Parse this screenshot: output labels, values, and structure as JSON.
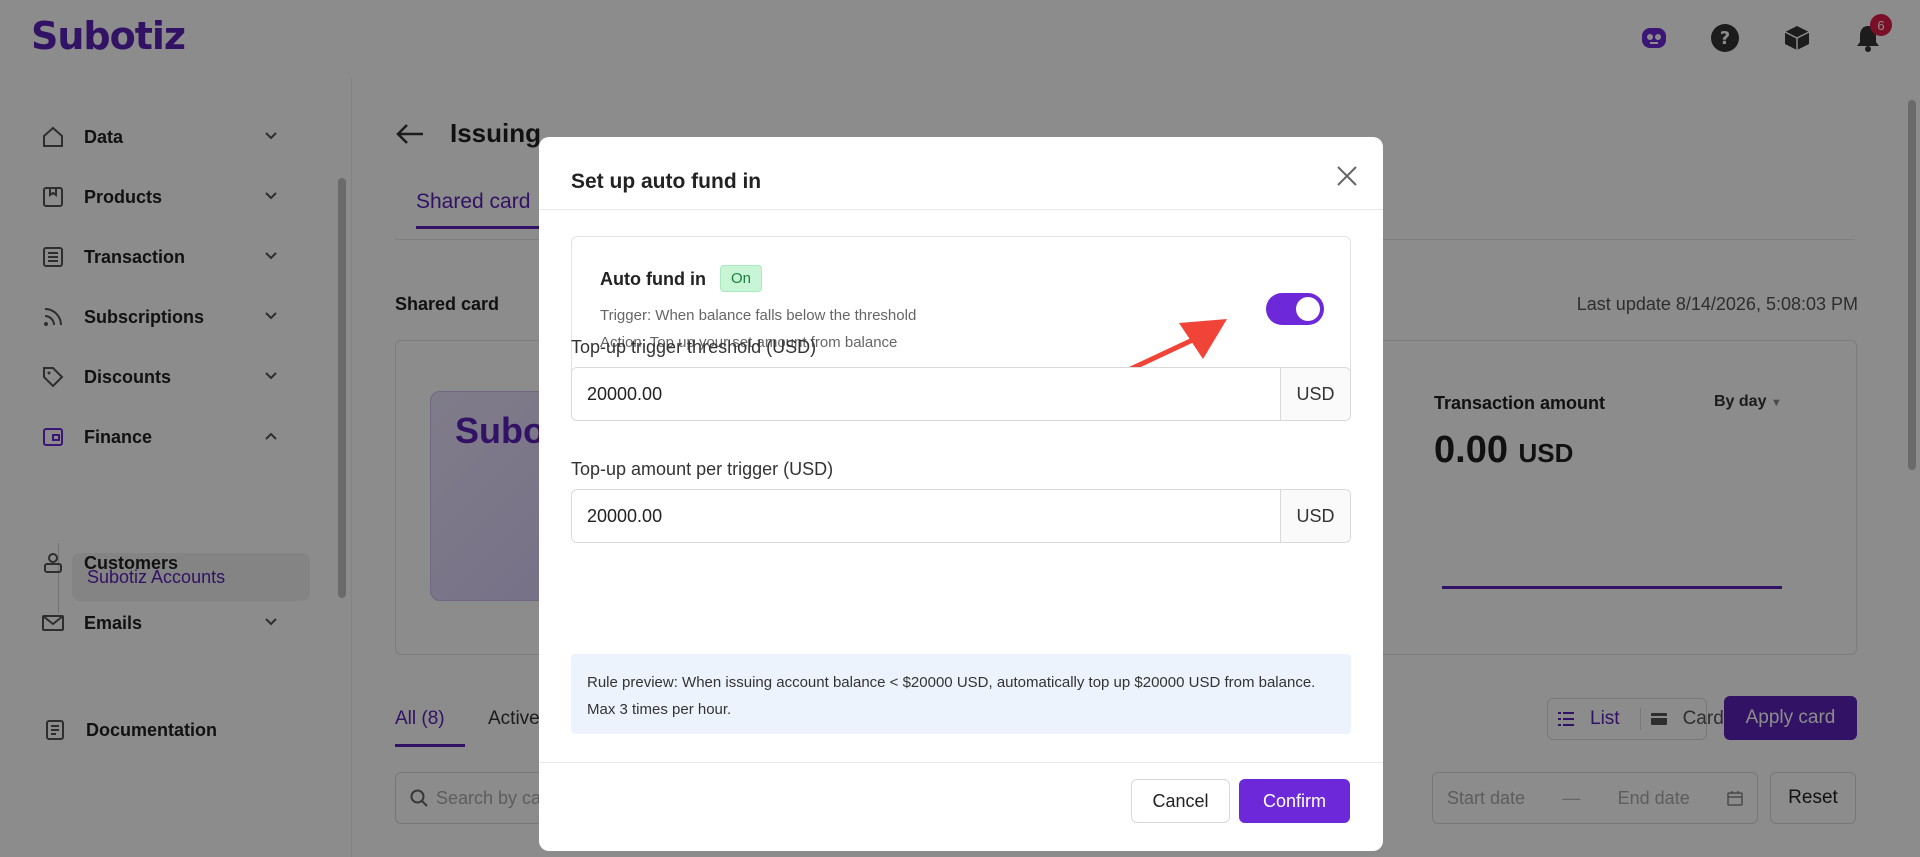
{
  "app": {
    "logo": "Subotiz",
    "notification_count": "6"
  },
  "sidebar": {
    "items": [
      {
        "label": "Data",
        "icon": "home-icon"
      },
      {
        "label": "Products",
        "icon": "box-icon"
      },
      {
        "label": "Transaction",
        "icon": "list-icon"
      },
      {
        "label": "Subscriptions",
        "icon": "rss-icon"
      },
      {
        "label": "Discounts",
        "icon": "tag-icon"
      },
      {
        "label": "Finance",
        "icon": "wallet-icon"
      },
      {
        "label": "Customers",
        "icon": "user-icon"
      },
      {
        "label": "Emails",
        "icon": "mail-icon"
      },
      {
        "label": "Documentation",
        "icon": "doc-icon"
      }
    ],
    "sub_item": "Subotiz Accounts"
  },
  "main": {
    "title": "Issuing",
    "tab": "Shared card",
    "section_title": "Shared card",
    "last_update": "Last update 8/14/2026, 5:08:03 PM",
    "card_brand": "Subot",
    "txn_label": "Transaction amount",
    "txn_value": "0.00",
    "txn_currency": "USD",
    "by_day": "By day",
    "filter_all": "All  (8)",
    "filter_active": "Active",
    "list_label": "List",
    "card_label": "Card",
    "apply_card": "Apply card",
    "search_placeholder": "Search by ca",
    "start_date": "Start date",
    "end_date": "End date",
    "reset": "Reset"
  },
  "modal": {
    "title": "Set up auto fund in",
    "auto_fund_title": "Auto fund in",
    "status": "On",
    "trigger": "Trigger: When balance falls below the threshold",
    "action": "Action: Top up your set amount from balance",
    "threshold_label": "Top-up trigger threshold (USD)",
    "threshold_value": "20000.00",
    "amount_label": "Top-up amount per trigger (USD)",
    "amount_value": "20000.00",
    "currency": "USD",
    "rule_preview": "Rule preview: When issuing account balance < $20000 USD, automatically top up $20000 USD from balance. Max 3 times per hour.",
    "cancel": "Cancel",
    "confirm": "Confirm"
  },
  "colors": {
    "brand": "#5b21b6",
    "toggle": "#6d28d9",
    "arrow": "#f04438"
  }
}
